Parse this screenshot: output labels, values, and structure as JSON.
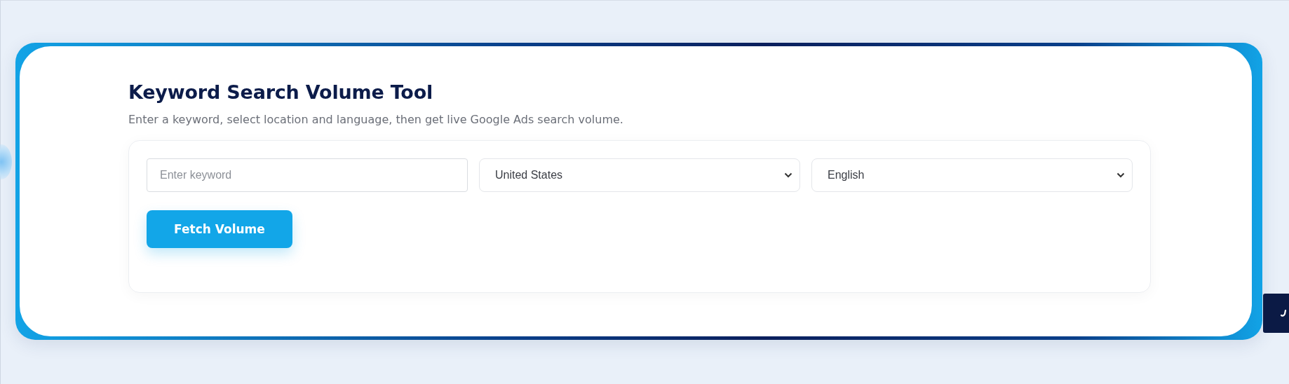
{
  "tool": {
    "title": "Keyword Search Volume Tool",
    "subtitle": "Enter a keyword, select location and language, then get live Google Ads search volume.",
    "keyword_field": {
      "placeholder": "Enter keyword"
    },
    "location_select": {
      "value": "United States"
    },
    "language_select": {
      "value": "English"
    },
    "submit_button": {
      "label": "Fetch Volume"
    }
  }
}
